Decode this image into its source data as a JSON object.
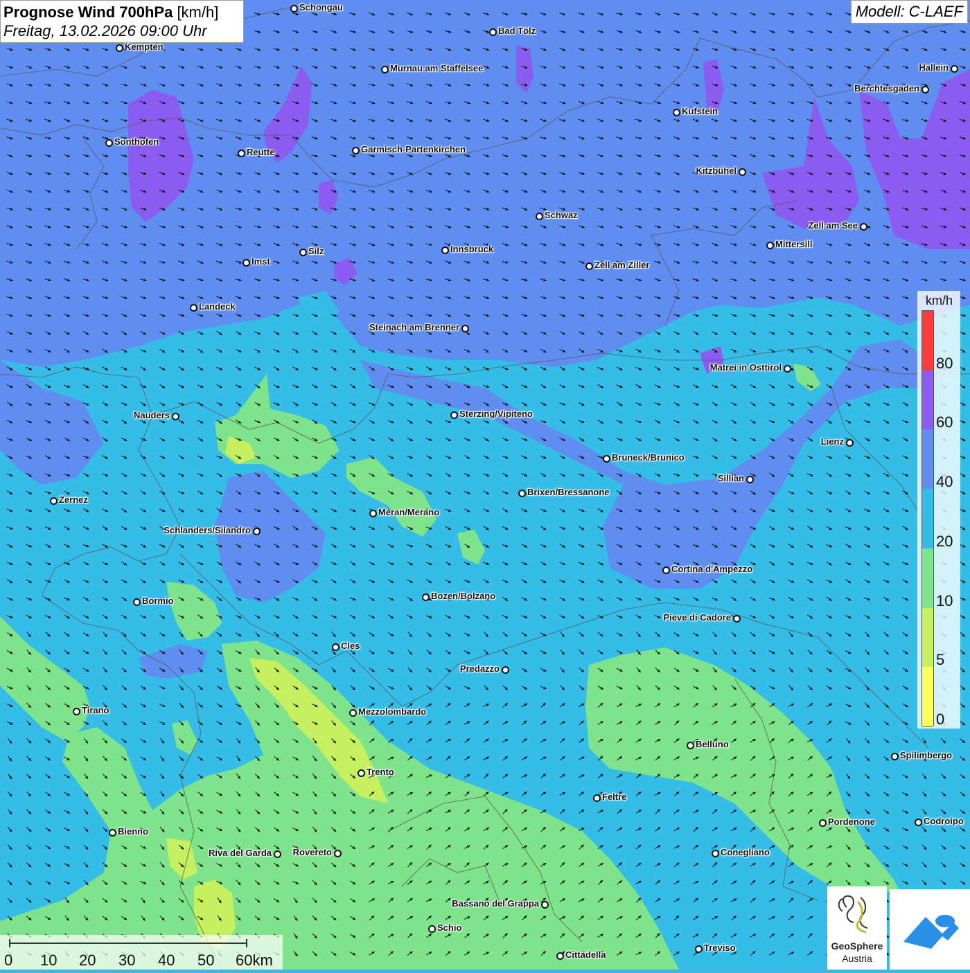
{
  "header": {
    "title": "Prognose Wind 700hPa",
    "unit": "[km/h]",
    "datetime": "Freitag, 13.02.2026 09:00 Uhr",
    "model": "Modell: C-LAEF"
  },
  "legend": {
    "unit": "km/h",
    "ticks": [
      "80",
      "60",
      "40",
      "20",
      "10",
      "5",
      "0"
    ],
    "colors": [
      "#ff3b3b",
      "#8a5cf0",
      "#5f8ef0",
      "#35bde8",
      "#7ee38a",
      "#c6f060",
      "#ffff5a"
    ]
  },
  "colors": {
    "wind_30_40": "#5f8ef0",
    "wind_40_60": "#8a5cf0",
    "wind_20_30": "#35bde8",
    "wind_10_20": "#7ee38a",
    "wind_5_10": "#c6f060",
    "wind_0_5": "#ffff5a"
  },
  "scale": {
    "labels": [
      "0",
      "10",
      "20",
      "30",
      "40",
      "50",
      "60km"
    ]
  },
  "logos": {
    "geosphere_line1": "GeoSphere",
    "geosphere_line2": "Austria"
  },
  "cities": [
    {
      "name": "Schongau"
    },
    {
      "name": "Bad Tölz"
    },
    {
      "name": "Kempten"
    },
    {
      "name": "Hallein"
    },
    {
      "name": "Murnau am Staffelsee"
    },
    {
      "name": "Berchtesgaden"
    },
    {
      "name": "Kufstein"
    },
    {
      "name": "Sonthofen"
    },
    {
      "name": "Reutte"
    },
    {
      "name": "Garmisch-Partenkirchen"
    },
    {
      "name": "Kitzbühel"
    },
    {
      "name": "Schwaz"
    },
    {
      "name": "Zell am See"
    },
    {
      "name": "Mittersill"
    },
    {
      "name": "Innsbruck"
    },
    {
      "name": "Silz"
    },
    {
      "name": "Imst"
    },
    {
      "name": "Zell am Ziller"
    },
    {
      "name": "Landeck"
    },
    {
      "name": "Steinach am Brenner"
    },
    {
      "name": "Matrei in Osttirol"
    },
    {
      "name": "Nauders"
    },
    {
      "name": "Sterzing/Vipiteno"
    },
    {
      "name": "Lienz"
    },
    {
      "name": "Bruneck/Brunico"
    },
    {
      "name": "Sillian"
    },
    {
      "name": "Zernez"
    },
    {
      "name": "Brixen/Bressanone"
    },
    {
      "name": "Meran/Merano"
    },
    {
      "name": "Schlanders/Silandro"
    },
    {
      "name": "Cortina d'Ampezzo"
    },
    {
      "name": "Bozen/Bolzano"
    },
    {
      "name": "Bormio"
    },
    {
      "name": "Pieve di Cadore"
    },
    {
      "name": "Cles"
    },
    {
      "name": "Predazzo"
    },
    {
      "name": "Tirano"
    },
    {
      "name": "Mezzolombardo"
    },
    {
      "name": "Belluno"
    },
    {
      "name": "Spilimbergo"
    },
    {
      "name": "Trento"
    },
    {
      "name": "Feltre"
    },
    {
      "name": "Pordenone"
    },
    {
      "name": "Codroipo"
    },
    {
      "name": "Bienno"
    },
    {
      "name": "Riva del Garda"
    },
    {
      "name": "Rovereto"
    },
    {
      "name": "Conegliano"
    },
    {
      "name": "Bassano del Grappa"
    },
    {
      "name": "Schio"
    },
    {
      "name": "Treviso"
    },
    {
      "name": "Cittadella"
    }
  ]
}
